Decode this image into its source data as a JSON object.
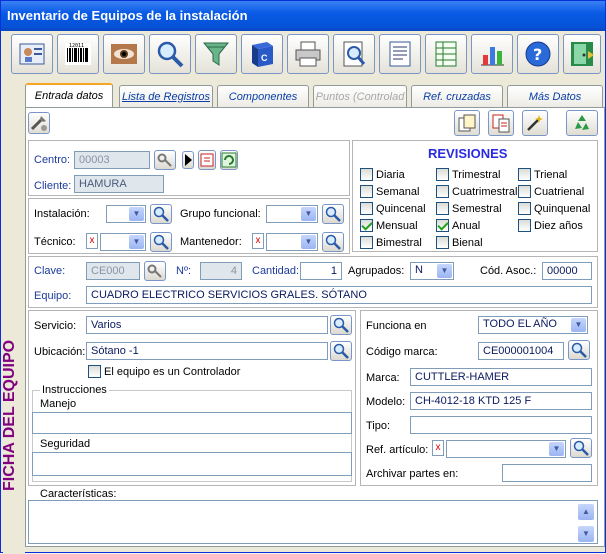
{
  "window": {
    "title": "Inventario de Equipos de la instalación"
  },
  "toolbar": {
    "icons": [
      "card-icon",
      "barcode-icon",
      "eye-icon",
      "magnifier-icon",
      "filter-icon",
      "book-icon",
      "printer-icon",
      "preview-icon",
      "document-icon",
      "spreadsheet-icon",
      "chart-icon",
      "help-icon",
      "exit-door-icon"
    ]
  },
  "sidebar": {
    "title": "FICHA DEL EQUIPO"
  },
  "tabs": [
    {
      "label": "Entrada datos"
    },
    {
      "label": "Lista de Registros"
    },
    {
      "label": "Componentes"
    },
    {
      "label": "Puntos (Controlad"
    },
    {
      "label": "Ref. cruzadas"
    },
    {
      "label": "Más Datos"
    }
  ],
  "centro": {
    "label": "Centro:",
    "value": "00003"
  },
  "cliente": {
    "label": "Cliente:",
    "value": "HAMURA"
  },
  "revisiones": {
    "title": "REVISIONES",
    "items": [
      {
        "label": "Diaria",
        "checked": false
      },
      {
        "label": "Trimestral",
        "checked": false
      },
      {
        "label": "Trienal",
        "checked": false
      },
      {
        "label": "Semanal",
        "checked": false
      },
      {
        "label": "Cuatrimestral",
        "checked": false
      },
      {
        "label": "Cuatrienal",
        "checked": false
      },
      {
        "label": "Quincenal",
        "checked": false
      },
      {
        "label": "Semestral",
        "checked": false
      },
      {
        "label": "Quinquenal",
        "checked": false
      },
      {
        "label": "Mensual",
        "checked": true
      },
      {
        "label": "Anual",
        "checked": true
      },
      {
        "label": "Diez años",
        "checked": false
      },
      {
        "label": "Bimestral",
        "checked": false
      },
      {
        "label": "Bienal",
        "checked": false
      }
    ]
  },
  "instalacion": {
    "label": "Instalación:",
    "value": ""
  },
  "grupo": {
    "label": "Grupo funcional:",
    "value": ""
  },
  "tecnico": {
    "label": "Técnico:",
    "value": ""
  },
  "mantenedor": {
    "label": "Mantenedor:",
    "value": ""
  },
  "clave": {
    "label": "Clave:",
    "value": "CE000"
  },
  "numero": {
    "label": "Nº:",
    "value": "4"
  },
  "cantidad": {
    "label": "Cantidad:",
    "value": "1"
  },
  "agrupados": {
    "label": "Agrupados:",
    "value": "N"
  },
  "cod_asoc": {
    "label": "Cód. Asoc.:",
    "value": "00000"
  },
  "equipo": {
    "label": "Equipo:",
    "value": "CUADRO ELECTRICO SERVICIOS GRALES. SÓTANO"
  },
  "servicio": {
    "label": "Servicio:",
    "value": "Varios"
  },
  "ubicacion": {
    "label": "Ubicación:",
    "value": "Sótano -1"
  },
  "controlador": {
    "label": "El equipo es un Controlador",
    "checked": false
  },
  "instrucciones": {
    "title": "Instrucciones",
    "manejo": "Manejo",
    "seguridad": "Seguridad"
  },
  "funciona": {
    "label": "Funciona en",
    "value": "TODO EL AÑO"
  },
  "codigo_marca": {
    "label": "Código marca:",
    "value": "CE000001004"
  },
  "marca": {
    "label": "Marca:",
    "value": "CUTTLER-HAMER"
  },
  "modelo": {
    "label": "Modelo:",
    "value": "CH-4012-18 KTD 125 F"
  },
  "tipo": {
    "label": "Tipo:",
    "value": ""
  },
  "ref_articulo": {
    "label": "Ref. artículo:",
    "value": ""
  },
  "archivar": {
    "label": "Archivar partes en:",
    "value": ""
  },
  "caracteristicas": {
    "label": "Características:",
    "value": ""
  }
}
